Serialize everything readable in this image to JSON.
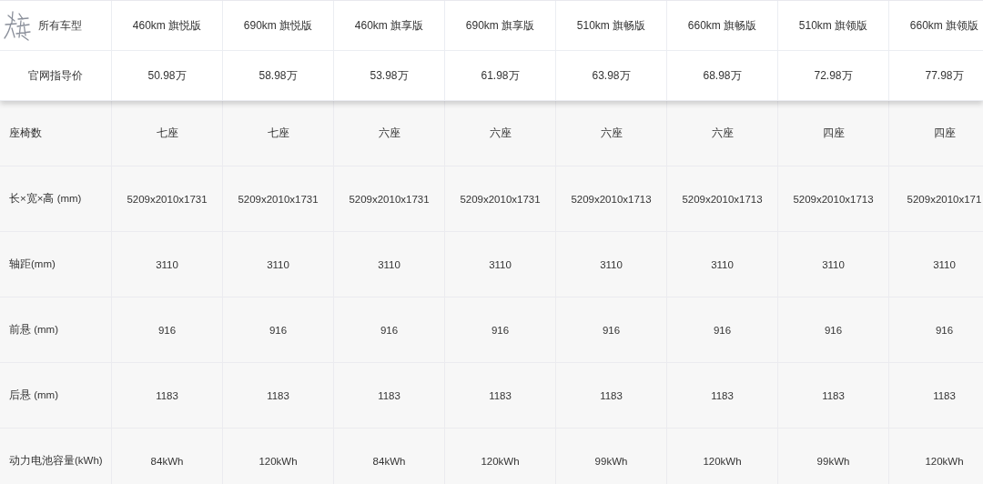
{
  "header": {
    "corner_label": "所有车型",
    "models": [
      "460km 旗悦版",
      "690km 旗悦版",
      "460km 旗享版",
      "690km 旗享版",
      "510km 旗畅版",
      "660km 旗畅版",
      "510km 旗领版",
      "660km 旗领版"
    ]
  },
  "price_row": {
    "label": "官网指导价",
    "values": [
      "50.98万",
      "58.98万",
      "53.98万",
      "61.98万",
      "63.98万",
      "68.98万",
      "72.98万",
      "77.98万"
    ]
  },
  "spec_rows": [
    {
      "label": "座椅数",
      "values": [
        "七座",
        "七座",
        "六座",
        "六座",
        "六座",
        "六座",
        "四座",
        "四座"
      ]
    },
    {
      "label": "长×宽×高 (mm)",
      "values": [
        "5209x2010x1731",
        "5209x2010x1731",
        "5209x2010x1731",
        "5209x2010x1731",
        "5209x2010x1713",
        "5209x2010x1713",
        "5209x2010x1713",
        "5209x2010x171"
      ]
    },
    {
      "label": "轴距(mm)",
      "values": [
        "3110",
        "3110",
        "3110",
        "3110",
        "3110",
        "3110",
        "3110",
        "3110"
      ]
    },
    {
      "label": "前悬 (mm)",
      "values": [
        "916",
        "916",
        "916",
        "916",
        "916",
        "916",
        "916",
        "916"
      ]
    },
    {
      "label": "后悬 (mm)",
      "values": [
        "1183",
        "1183",
        "1183",
        "1183",
        "1183",
        "1183",
        "1183",
        "1183"
      ]
    },
    {
      "label": "动力电池容量(kWh)",
      "values": [
        "84kWh",
        "120kWh",
        "84kWh",
        "120kWh",
        "99kWh",
        "120kWh",
        "99kWh",
        "120kWh"
      ]
    }
  ]
}
